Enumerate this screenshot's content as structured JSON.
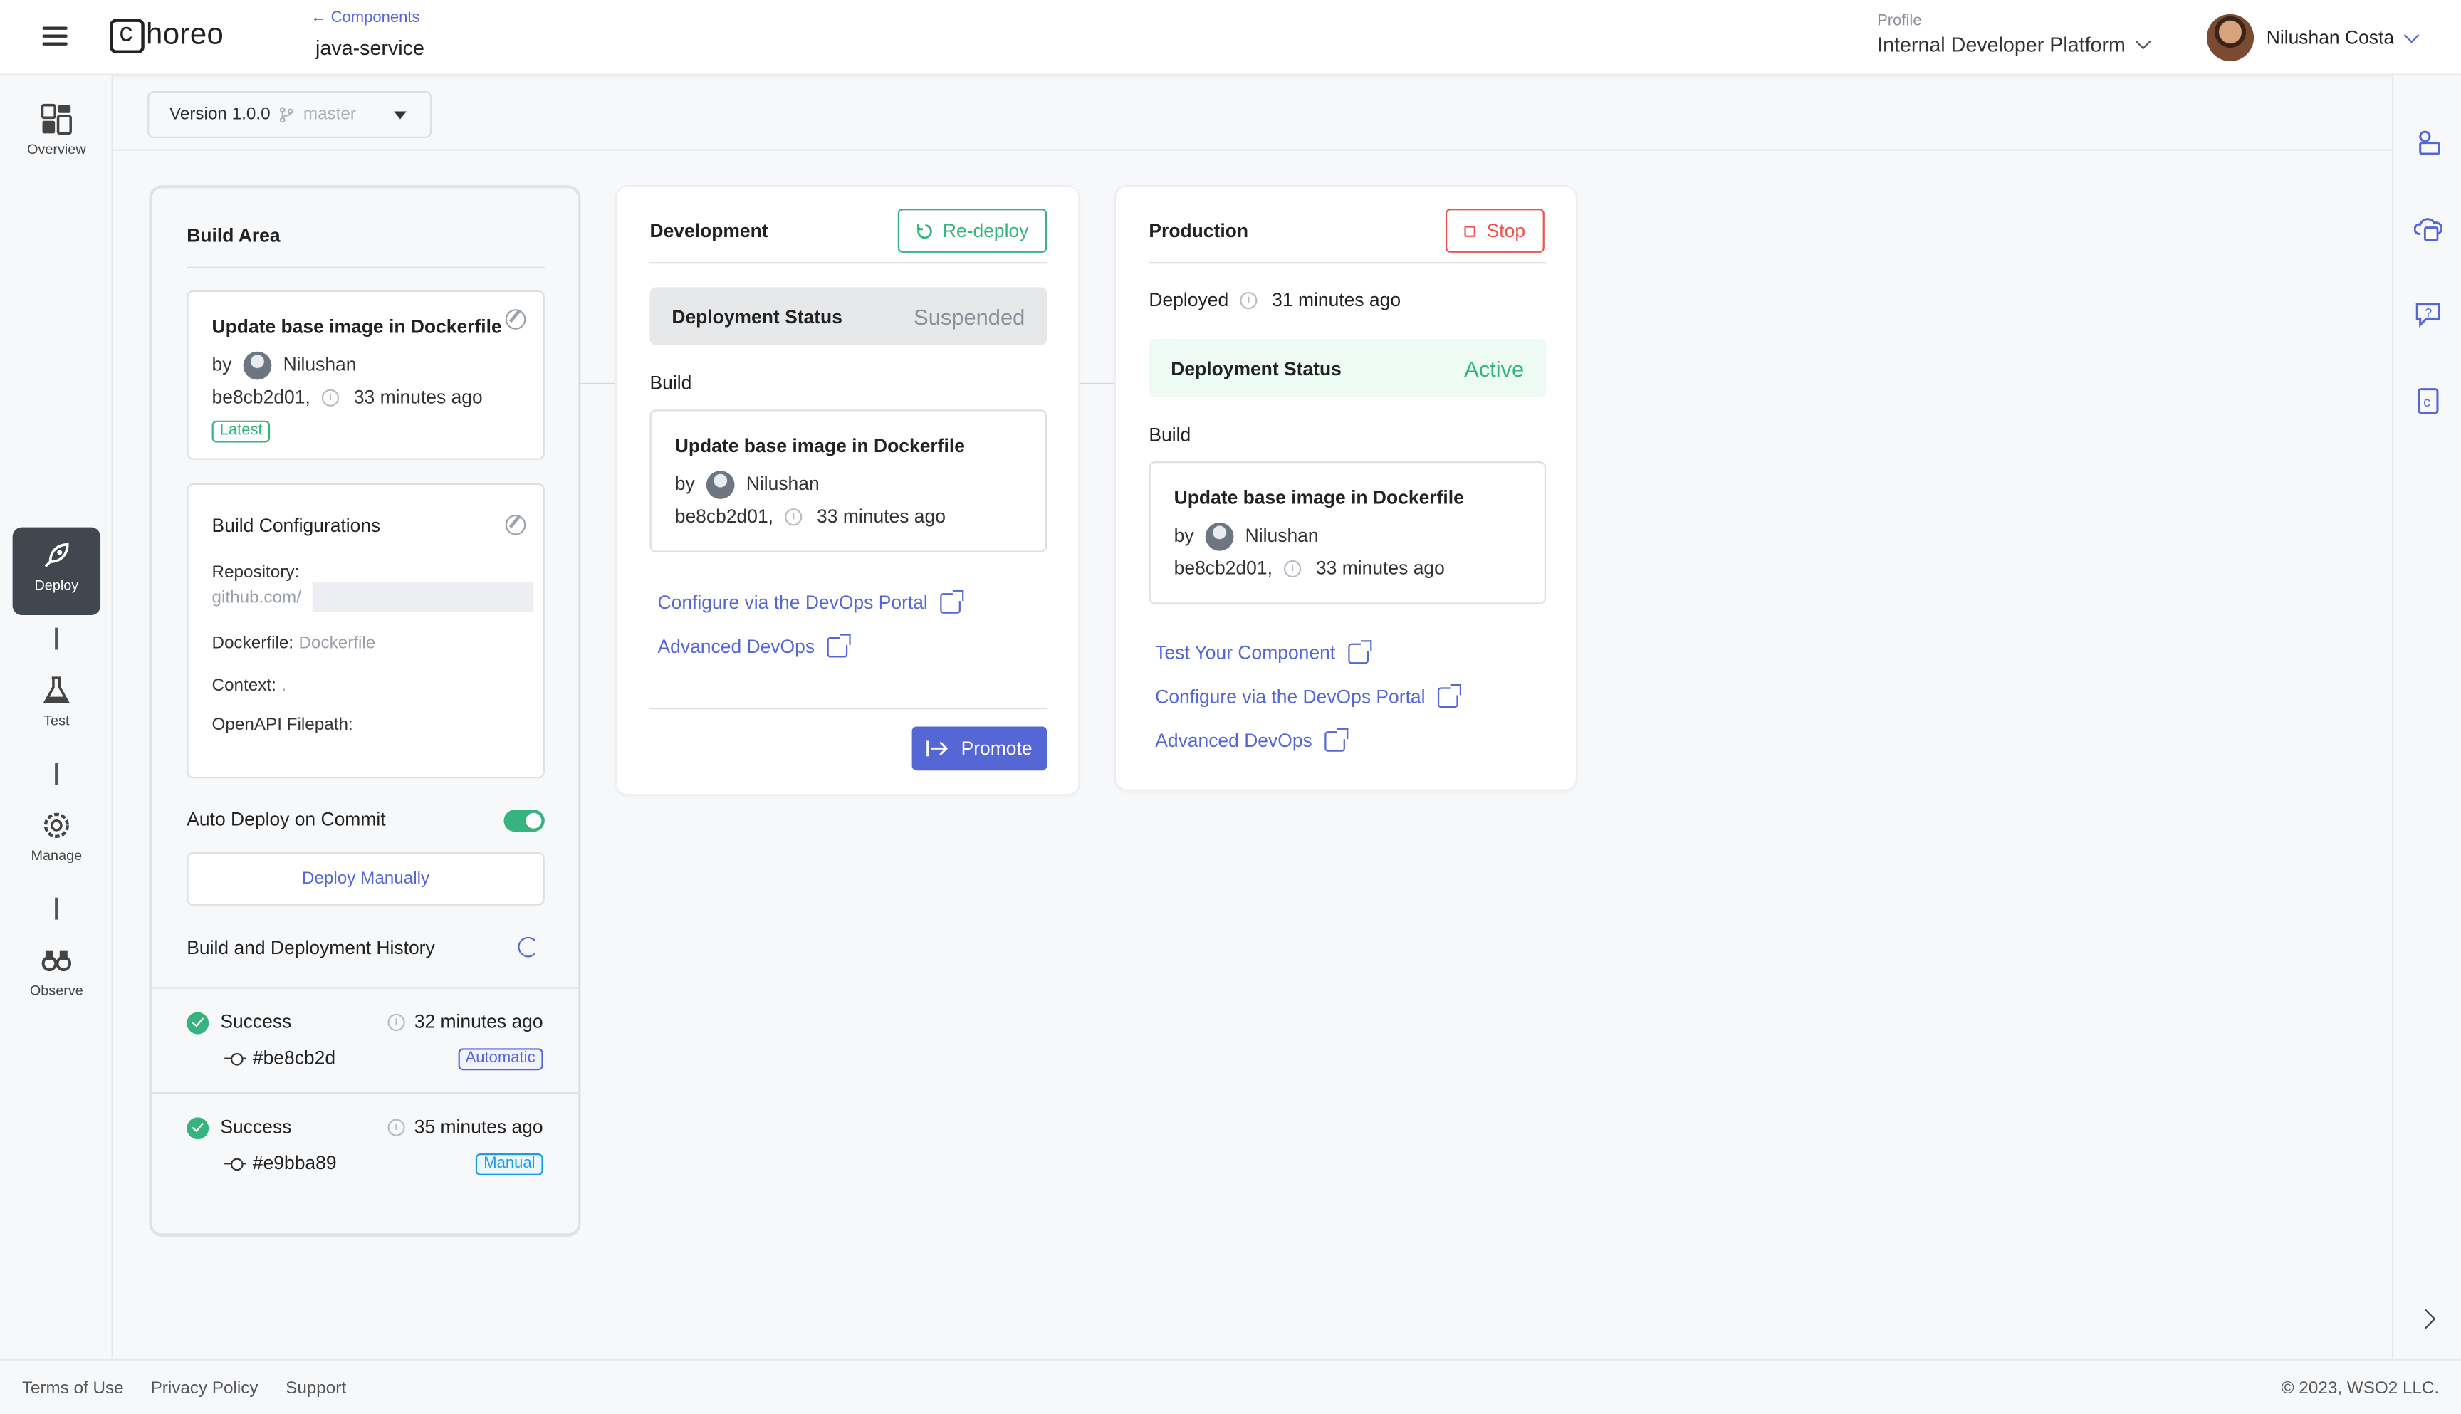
{
  "header": {
    "logo_text": "horeo",
    "back_link": "← Components",
    "component_name": "java-service",
    "profile_label": "Profile",
    "profile_value": "Internal Developer Platform",
    "user_name": "Nilushan Costa"
  },
  "leftnav": {
    "items": [
      {
        "label": "Overview",
        "icon": "overview-icon"
      },
      {
        "label": "Deploy",
        "icon": "rocket-icon",
        "active": true
      },
      {
        "label": "Test",
        "icon": "flask-icon"
      },
      {
        "label": "Manage",
        "icon": "gear-icon"
      },
      {
        "label": "Observe",
        "icon": "binoculars-icon"
      }
    ]
  },
  "version": {
    "label": "Version 1.0.0",
    "branch": "master"
  },
  "build_area": {
    "title": "Build Area",
    "latest_commit": {
      "title": "Update base image in Dockerfile",
      "by_label": "by",
      "author": "Nilushan",
      "hash": "be8cb2d01,",
      "time": "33 minutes ago",
      "tag": "Latest"
    },
    "configurations": {
      "title": "Build Configurations",
      "repository_label": "Repository:",
      "repository_value": "github.com/",
      "dockerfile_label": "Dockerfile:",
      "dockerfile_value": "Dockerfile",
      "context_label": "Context:",
      "context_value": ".",
      "openapi_label": "OpenAPI Filepath:"
    },
    "auto_deploy_label": "Auto Deploy on Commit",
    "auto_deploy_on": true,
    "deploy_manually": "Deploy Manually",
    "history_title": "Build and Deployment History",
    "history": [
      {
        "status": "Success",
        "time": "32 minutes ago",
        "commit": "#be8cb2d",
        "trigger": "Automatic"
      },
      {
        "status": "Success",
        "time": "35 minutes ago",
        "commit": "#e9bba89",
        "trigger": "Manual"
      }
    ]
  },
  "development": {
    "title": "Development",
    "redeploy": "Re-deploy",
    "status_label": "Deployment Status",
    "status_value": "Suspended",
    "build_label": "Build",
    "commit_title": "Update base image in Dockerfile",
    "by_label": "by",
    "author": "Nilushan",
    "hash": "be8cb2d01,",
    "time": "33 minutes ago",
    "links": [
      "Configure via the DevOps Portal",
      "Advanced DevOps"
    ],
    "promote": "Promote"
  },
  "production": {
    "title": "Production",
    "stop": "Stop",
    "deployed_label": "Deployed",
    "deployed_time": "31 minutes ago",
    "status_label": "Deployment Status",
    "status_value": "Active",
    "build_label": "Build",
    "commit_title": "Update base image in Dockerfile",
    "by_label": "by",
    "author": "Nilushan",
    "hash": "be8cb2d01,",
    "time": "33 minutes ago",
    "links": [
      "Test Your Component",
      "Configure via the DevOps Portal",
      "Advanced DevOps"
    ]
  },
  "footer": {
    "terms": "Terms of Use",
    "privacy": "Privacy Policy",
    "support": "Support",
    "copyright": "© 2023, WSO2 LLC."
  },
  "colors": {
    "accent": "#5567d5",
    "success": "#36b37e",
    "danger": "#ef5350",
    "nav_active": "#40474f"
  }
}
